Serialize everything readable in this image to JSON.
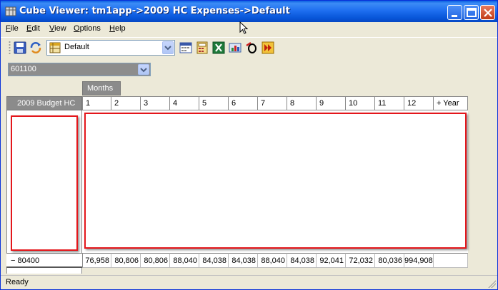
{
  "window": {
    "title": "Cube Viewer:  tm1app->2009 HC Expenses->Default"
  },
  "menu": [
    "File",
    "Edit",
    "View",
    "Options",
    "Help"
  ],
  "toolbar": {
    "view_name": "Default",
    "icons": [
      "save-icon",
      "recalculate-icon",
      "view-icon",
      "calendar-icon",
      "calculator-icon",
      "excel-icon",
      "chart-icon",
      "zero-suppress-icon",
      "fast-forward-icon"
    ]
  },
  "title_dimension": {
    "value": "601100"
  },
  "grid": {
    "column_dimension": "Months",
    "row_dimension": "2009 Budget HC",
    "columns": [
      "1",
      "2",
      "3",
      "4",
      "5",
      "6",
      "7",
      "8",
      "9",
      "10",
      "11",
      "12",
      "+  Year"
    ],
    "rows": [
      {
        "label": "−  80400",
        "values": [
          "76,958",
          "80,806",
          "80,806",
          "88,040",
          "84,038",
          "84,038",
          "88,040",
          "84,038",
          "92,041",
          "72,032",
          "80,036",
          "994,908"
        ]
      }
    ]
  },
  "status": "Ready",
  "colors": {
    "title_bar": "#0a5fe0",
    "redaction_border": "#e4161b",
    "dimension_tab": "#8b8b8b"
  }
}
